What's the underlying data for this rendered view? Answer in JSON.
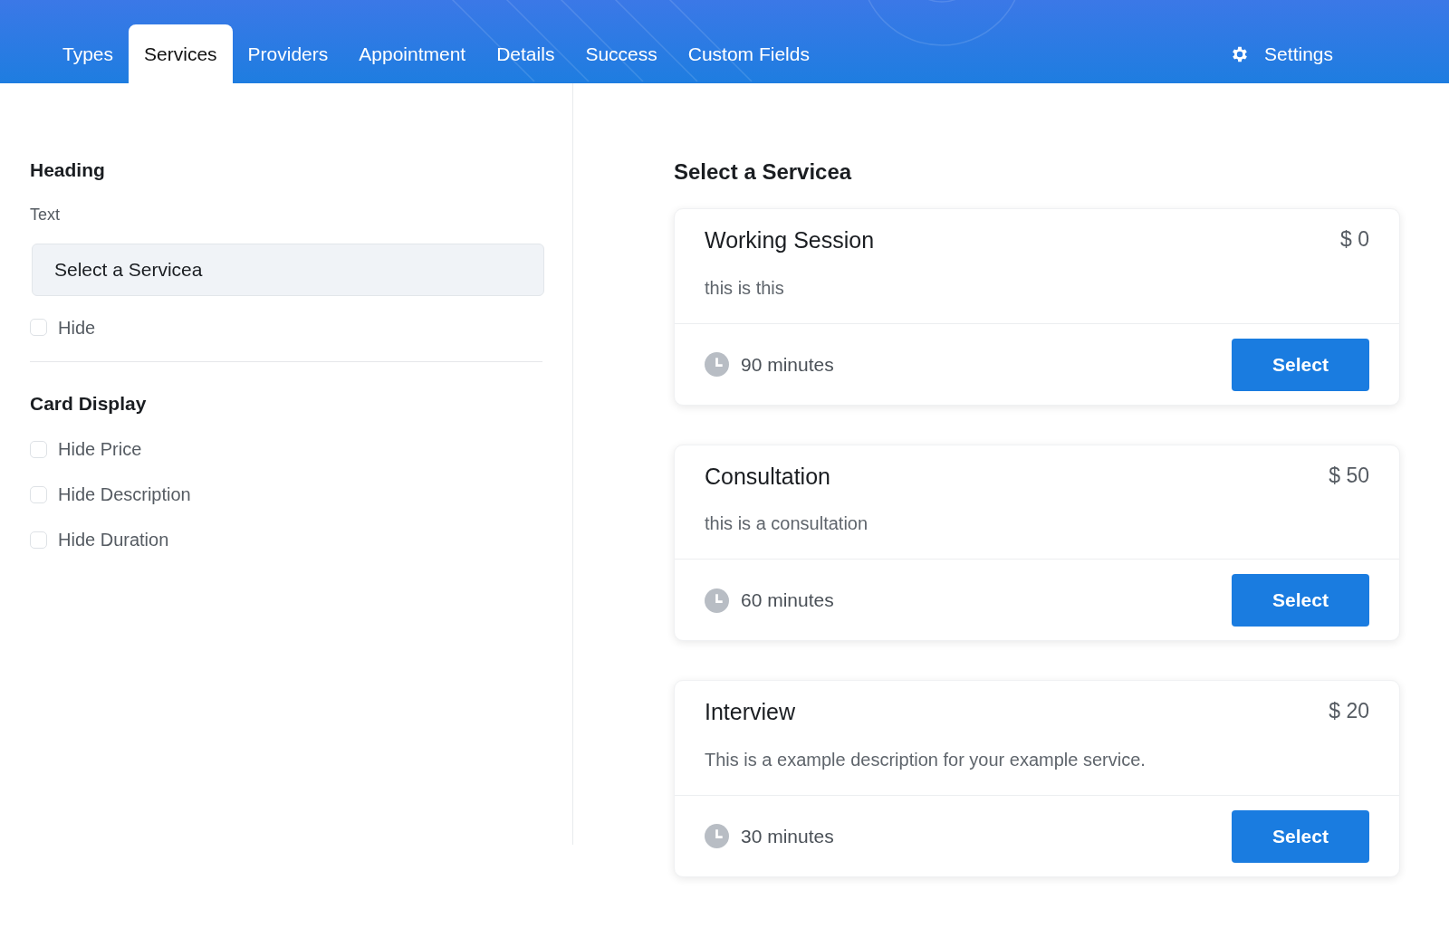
{
  "tabs": [
    {
      "label": "Types",
      "selected": false
    },
    {
      "label": "Services",
      "selected": true
    },
    {
      "label": "Providers",
      "selected": false
    },
    {
      "label": "Appointment",
      "selected": false
    },
    {
      "label": "Details",
      "selected": false
    },
    {
      "label": "Success",
      "selected": false
    },
    {
      "label": "Custom Fields",
      "selected": false
    }
  ],
  "settings": {
    "label": "Settings"
  },
  "sidebar": {
    "sections": [
      {
        "title": "Heading",
        "field_label": "Text",
        "field_value": "Select a Servicea",
        "options": [
          {
            "label": "Hide",
            "checked": false
          }
        ]
      },
      {
        "title": "Card Display",
        "options": [
          {
            "label": "Hide Price",
            "checked": false
          },
          {
            "label": "Hide Description",
            "checked": false
          },
          {
            "label": "Hide Duration",
            "checked": false
          }
        ]
      }
    ]
  },
  "preview": {
    "title": "Select a Servicea",
    "services": [
      {
        "name": "Working Session",
        "price": "$ 0",
        "description": "this is this",
        "duration": "90 minutes",
        "button": "Select"
      },
      {
        "name": "Consultation",
        "price": "$ 50",
        "description": "this is a consultation",
        "duration": "60 minutes",
        "button": "Select"
      },
      {
        "name": "Interview",
        "price": "$ 20",
        "description": "This is a example description for your example service.",
        "duration": "30 minutes",
        "button": "Select"
      }
    ]
  }
}
